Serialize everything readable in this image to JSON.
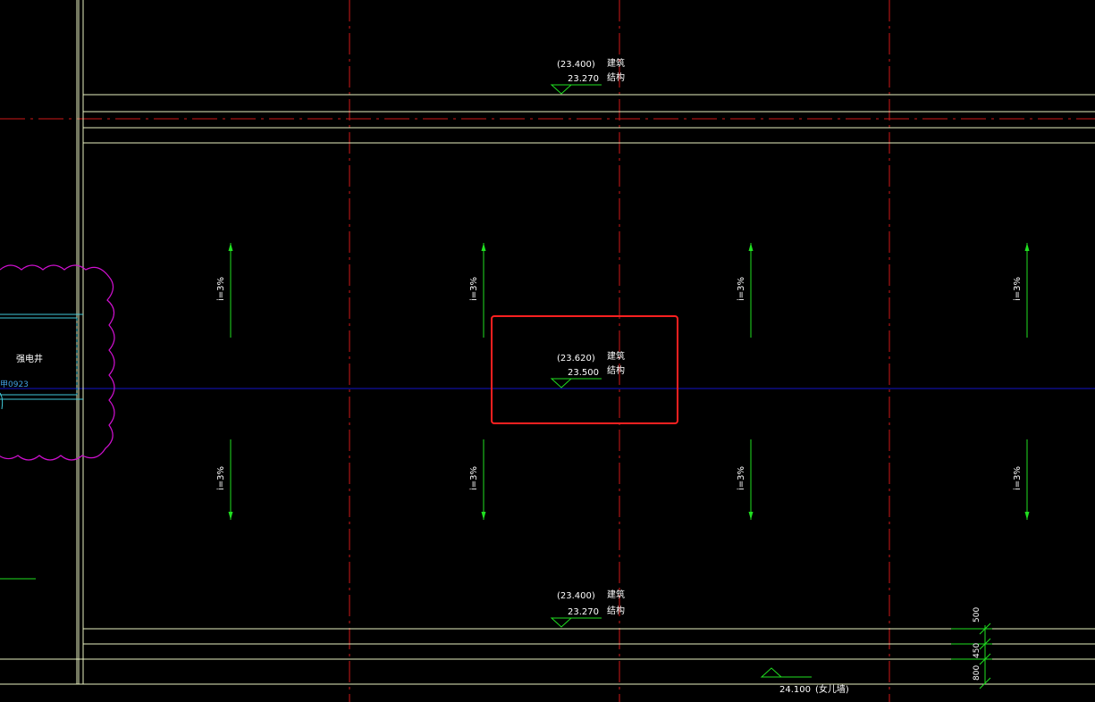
{
  "colors": {
    "background": "#000000",
    "grid_axis": "#d01818",
    "slab_edge": "#e8f0c0",
    "axis_blue": "#1010c8",
    "slope_arrow": "#20e020",
    "annotation_text": "#ffffff",
    "revision_cloud": "#d010d0",
    "room_outline": "#40c8d8",
    "door_tag": "#40a0e0",
    "highlight_box": "#ff2020"
  },
  "elevations": [
    {
      "id": "top",
      "architectural": "(23.400)",
      "structural": "23.270",
      "arch_label": "建筑",
      "struct_label": "结构"
    },
    {
      "id": "middle",
      "architectural": "(23.620)",
      "structural": "23.500",
      "arch_label": "建筑",
      "struct_label": "结构"
    },
    {
      "id": "bottom",
      "architectural": "(23.400)",
      "structural": "23.270",
      "arch_label": "建筑",
      "struct_label": "结构"
    }
  ],
  "parapet": {
    "elevation": "24.100",
    "label": "(女儿墙)"
  },
  "slopes": [
    {
      "label": "i=3%",
      "direction": "up"
    },
    {
      "label": "i=3%",
      "direction": "up"
    },
    {
      "label": "i=3%",
      "direction": "up"
    },
    {
      "label": "i=3%",
      "direction": "up"
    },
    {
      "label": "i=3%",
      "direction": "down"
    },
    {
      "label": "i=3%",
      "direction": "down"
    },
    {
      "label": "i=3%",
      "direction": "down"
    },
    {
      "label": "i=3%",
      "direction": "down"
    }
  ],
  "room": {
    "name": "强电井",
    "door_tag": "甲0923"
  },
  "section_dimensions": [
    "500",
    "450",
    "800"
  ]
}
